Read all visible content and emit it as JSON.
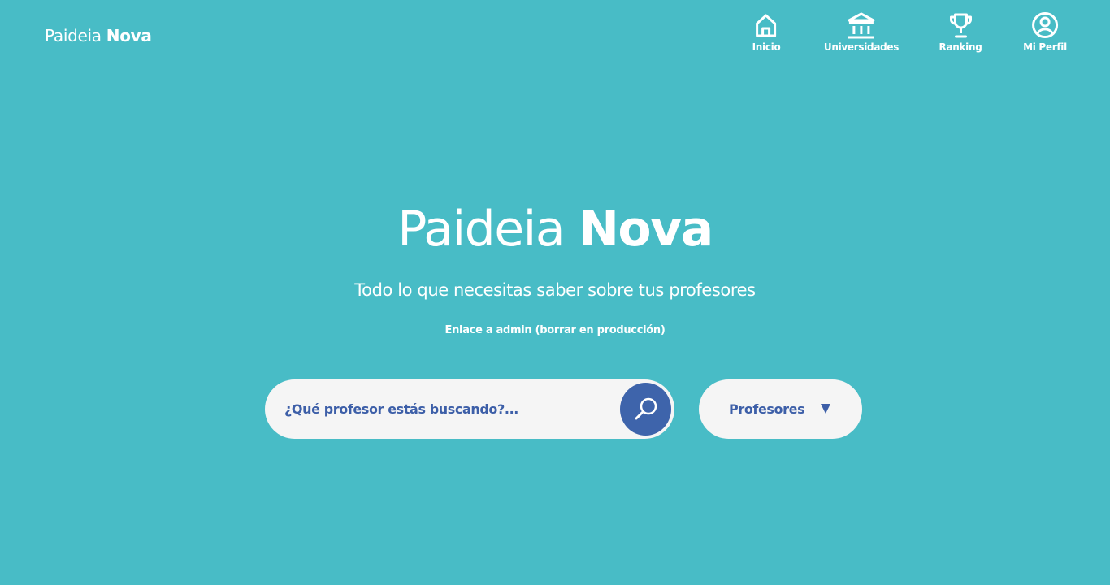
{
  "brand": {
    "regular": "Paideia ",
    "bold": "Nova"
  },
  "nav": {
    "items": [
      {
        "label": "Inicio",
        "icon": "home-icon"
      },
      {
        "label": "Universidades",
        "icon": "university-icon"
      },
      {
        "label": "Ranking",
        "icon": "trophy-icon"
      },
      {
        "label": "Mi Perfil",
        "icon": "user-circle-icon"
      }
    ]
  },
  "hero": {
    "title_regular": "Paideia ",
    "title_bold": "Nova",
    "subtitle": "Todo lo que necesitas saber sobre tus profesores",
    "admin_link": "Enlace a admin (borrar en producción)"
  },
  "search": {
    "placeholder": "¿Qué profesor estás buscando?...",
    "value": "",
    "button_icon": "search-icon"
  },
  "filter": {
    "selected": "Profesores",
    "icon": "caret-down-icon"
  },
  "colors": {
    "background": "#48bcc6",
    "accent": "#3e64ab",
    "text_dark": "#3d5fa8",
    "input_bg": "#f5f5f5",
    "text_light": "#ffffff"
  }
}
